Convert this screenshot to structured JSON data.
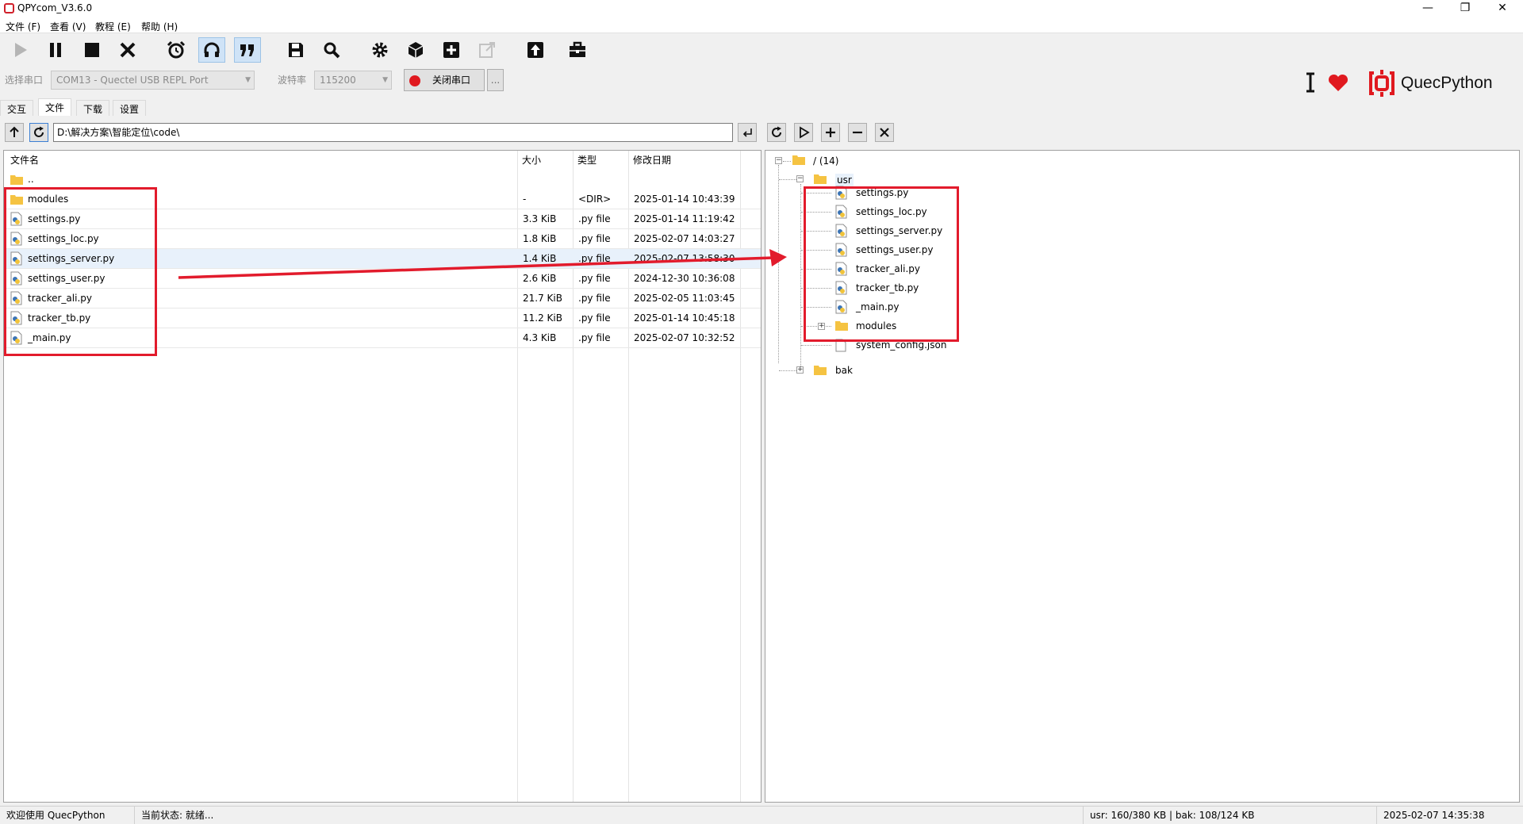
{
  "window": {
    "title": "QPYcom_V3.6.0"
  },
  "menu": [
    "文件 (F)",
    "查看 (V)",
    "教程 (E)",
    "帮助 (H)"
  ],
  "toolbar": {
    "icons": [
      "run-icon",
      "pause-icon",
      "stop-icon",
      "close-icon",
      "alarm-icon",
      "headset-icon",
      "quote-icon",
      "save-icon",
      "search-icon",
      "gear-icon",
      "package-icon",
      "plus-box-icon",
      "export-icon",
      "upload-icon",
      "toolbox-icon"
    ]
  },
  "serial": {
    "port_label": "选择串口",
    "port_value": "COM13 - Quectel USB REPL Port",
    "baud_label": "波特率",
    "baud_value": "115200",
    "toggle_button": "关闭串口",
    "more_button": "..."
  },
  "brand": {
    "name": "QuecPython"
  },
  "tabs": [
    "交互",
    "文件",
    "下载",
    "设置"
  ],
  "selected_tab": "文件",
  "local": {
    "path": "D:\\解决方案\\智能定位\\code\\",
    "columns": [
      "文件名",
      "大小",
      "类型",
      "修改日期"
    ],
    "parent": "..",
    "rows": [
      {
        "name": "modules",
        "size": "-",
        "type": "<DIR>",
        "date": "2025-01-14 10:43:39"
      },
      {
        "name": "settings.py",
        "size": "3.3 KiB",
        "type": ".py file",
        "date": "2025-01-14 11:19:42"
      },
      {
        "name": "settings_loc.py",
        "size": "1.8 KiB",
        "type": ".py file",
        "date": "2025-02-07 14:03:27"
      },
      {
        "name": "settings_server.py",
        "size": "1.4 KiB",
        "type": ".py file",
        "date": "2025-02-07 13:58:30"
      },
      {
        "name": "settings_user.py",
        "size": "2.6 KiB",
        "type": ".py file",
        "date": "2024-12-30 10:36:08"
      },
      {
        "name": "tracker_ali.py",
        "size": "21.7 KiB",
        "type": ".py file",
        "date": "2025-02-05 11:03:45"
      },
      {
        "name": "tracker_tb.py",
        "size": "11.2 KiB",
        "type": ".py file",
        "date": "2025-01-14 10:45:18"
      },
      {
        "name": "_main.py",
        "size": "4.3 KiB",
        "type": ".py file",
        "date": "2025-02-07 10:32:52"
      }
    ]
  },
  "device": {
    "root": "/ (14)",
    "usr": "usr",
    "usr_children": [
      "settings.py",
      "settings_loc.py",
      "settings_server.py",
      "settings_user.py",
      "tracker_ali.py",
      "tracker_tb.py",
      "_main.py",
      "modules",
      "system_config.json"
    ],
    "bak": "bak"
  },
  "status": {
    "welcome": "欢迎使用 QuecPython",
    "state": "当前状态: 就绪...",
    "storage": "usr: 160/380 KB | bak: 108/124 KB",
    "datetime": "2025-02-07 14:35:38"
  },
  "colors": {
    "highlight": "#e21b2c",
    "accent": "#d0202a"
  }
}
